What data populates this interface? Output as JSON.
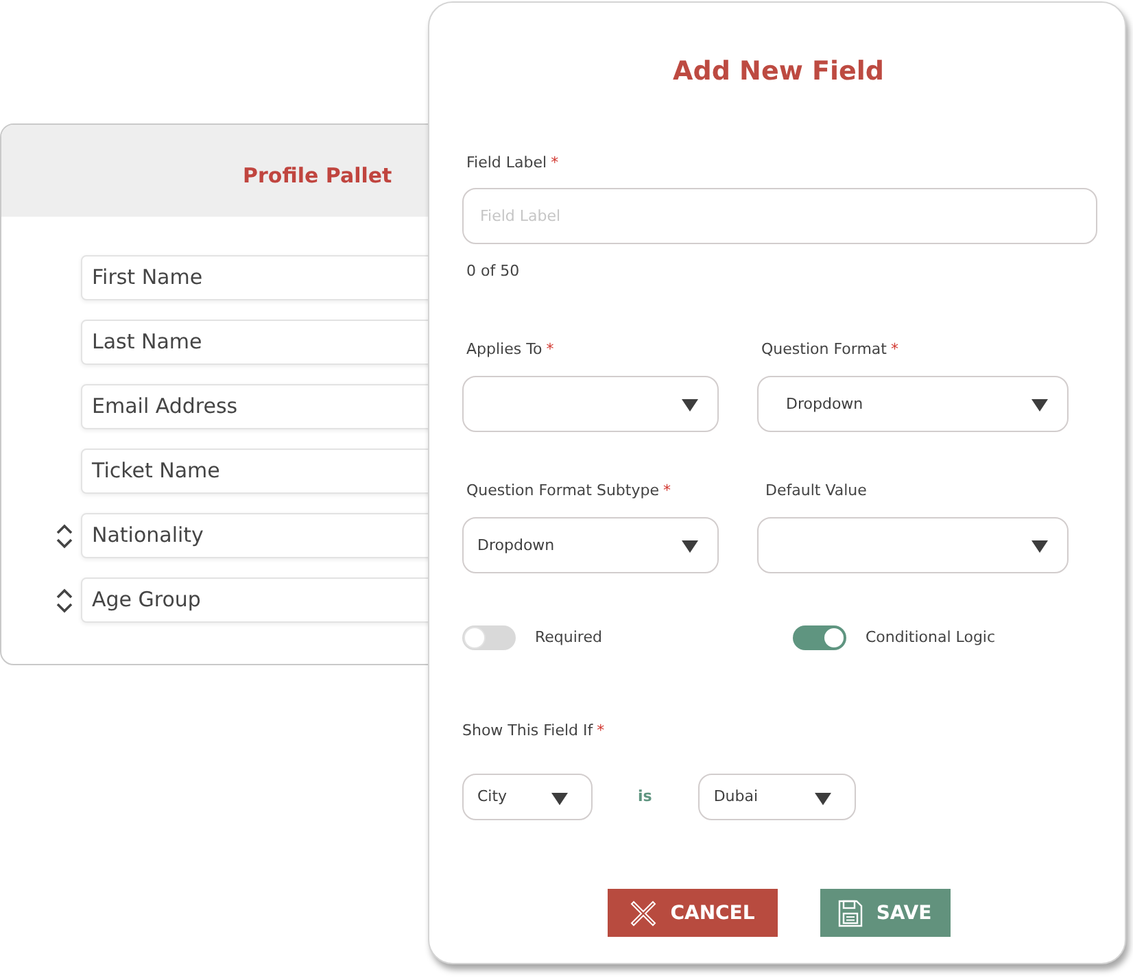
{
  "profile_pallet": {
    "title": "Profile Pallet",
    "fields": [
      {
        "label": "First Name",
        "sortable": false
      },
      {
        "label": "Last Name",
        "sortable": false
      },
      {
        "label": "Email Address",
        "sortable": false
      },
      {
        "label": "Ticket Name",
        "sortable": false
      },
      {
        "label": "Nationality",
        "sortable": true
      },
      {
        "label": "Age Group",
        "sortable": true
      }
    ]
  },
  "dialog": {
    "title": "Add New Field",
    "field_label": {
      "label": "Field Label",
      "required_mark": "*",
      "placeholder": "Field Label",
      "counter": "0 of 50"
    },
    "selects": [
      {
        "label": "Applies To",
        "required_mark": "*"
      },
      {
        "label": "Question Format",
        "required_mark": "*",
        "value": "Dropdown"
      },
      {
        "label": "Question Format Subtype",
        "required_mark": "*",
        "value": "Dropdown"
      },
      {
        "label": "Default Value"
      }
    ],
    "toggles": [
      {
        "label": "Required",
        "on": false
      },
      {
        "label": "Conditional Logic",
        "on": true
      }
    ],
    "condition": {
      "label": "Show This Field If",
      "required_mark": "*",
      "field": "City",
      "operator": "is",
      "value": "Dubai"
    },
    "buttons": [
      {
        "label": "CANCEL",
        "kind": "cancel"
      },
      {
        "label": "SAVE",
        "kind": "save"
      }
    ]
  }
}
